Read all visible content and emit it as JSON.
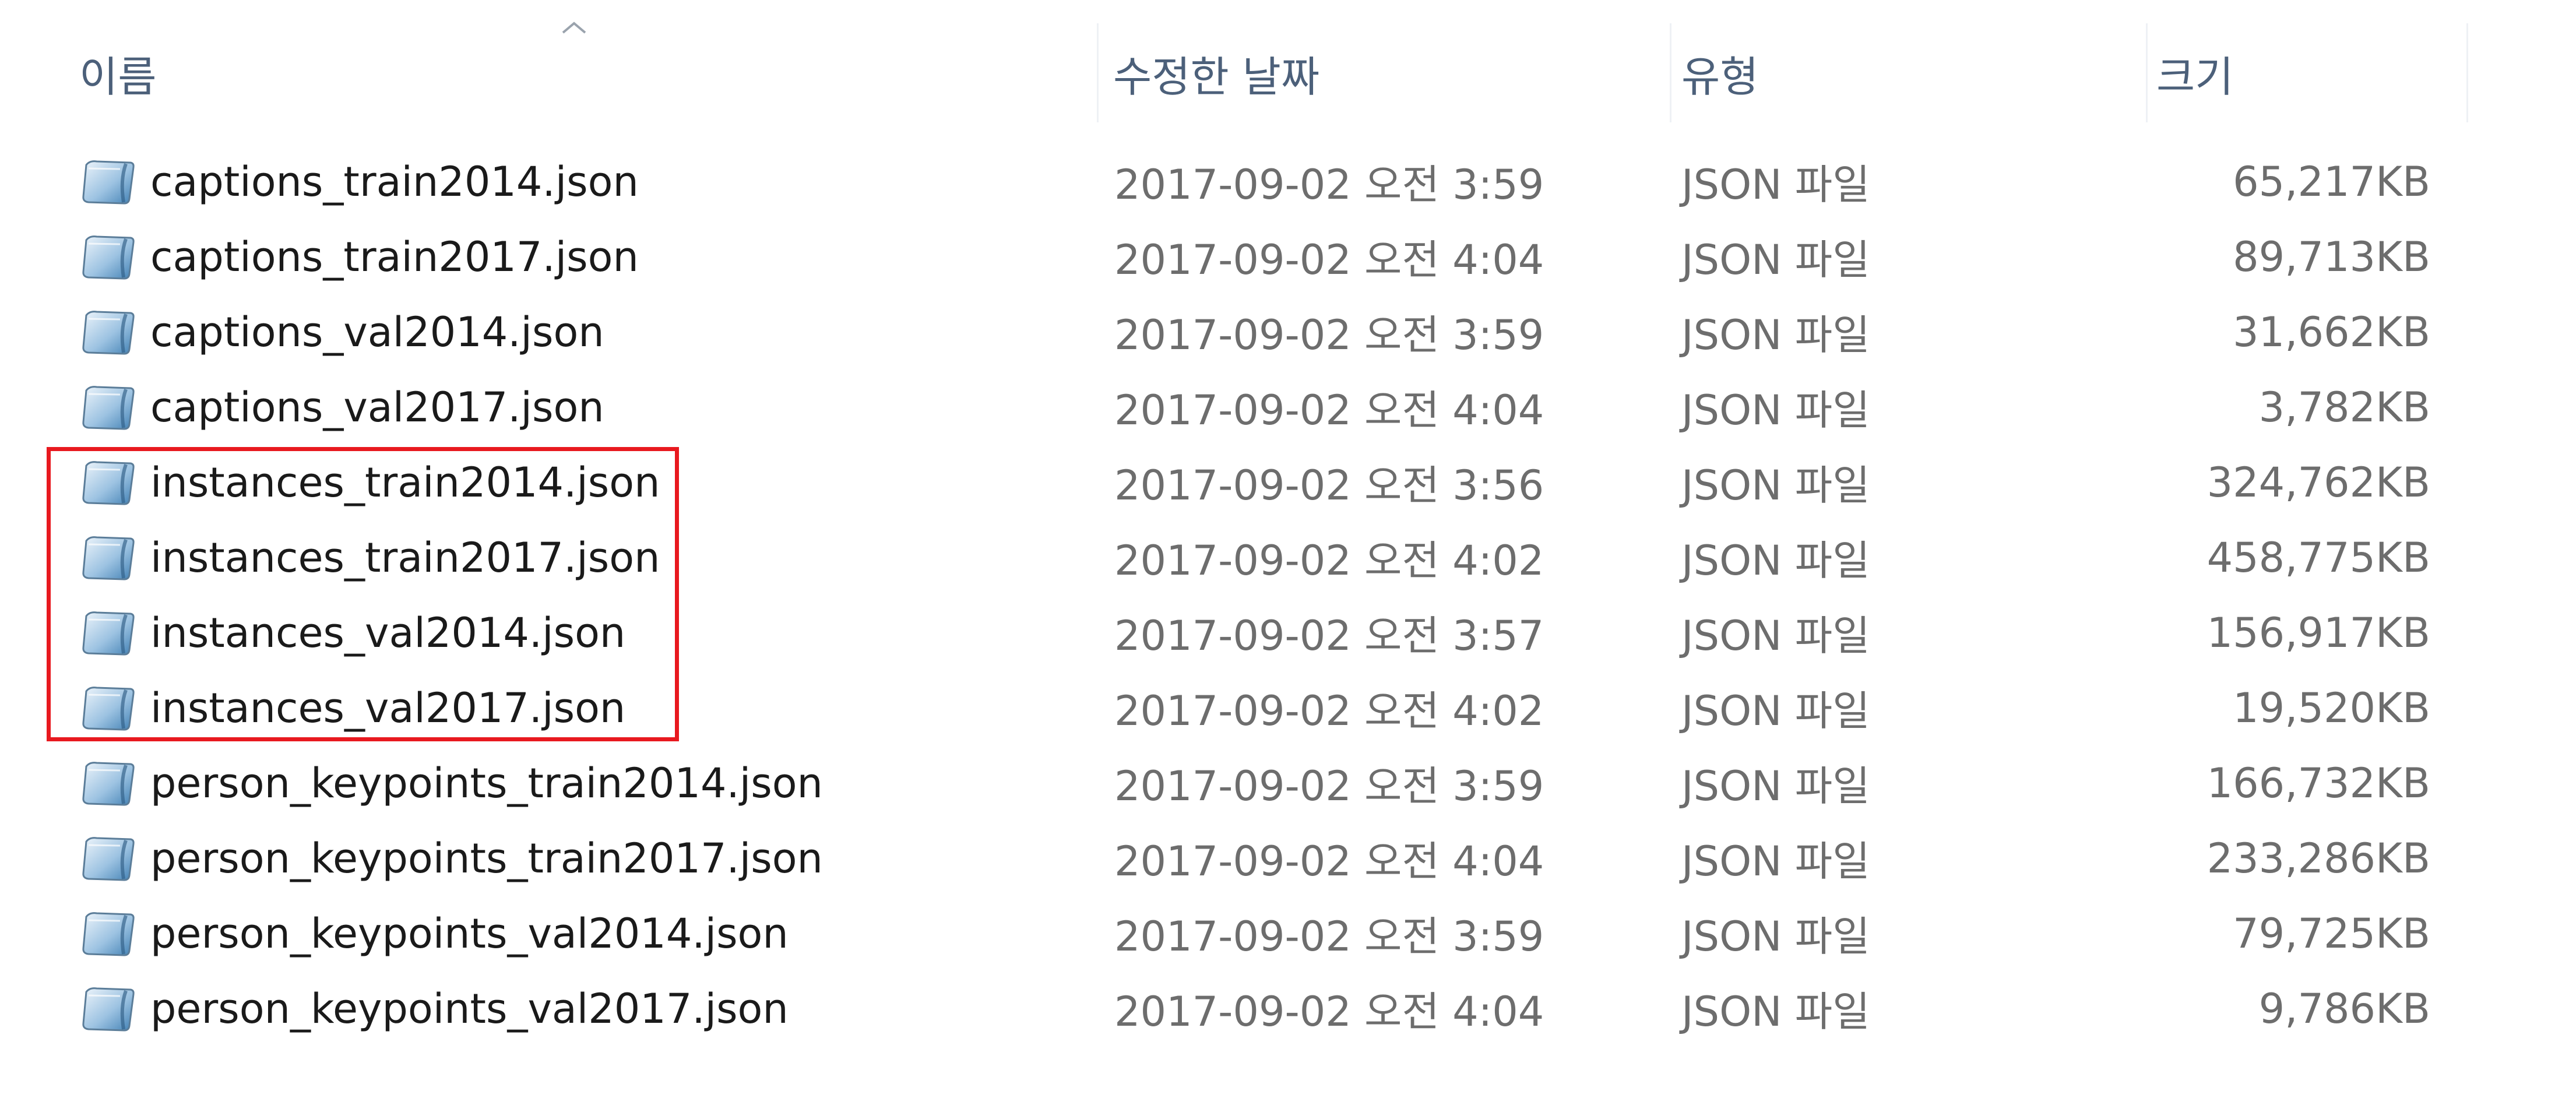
{
  "header": {
    "columns": {
      "name": "이름",
      "date": "수정한 날짜",
      "type": "유형",
      "size": "크기"
    }
  },
  "files": [
    {
      "name": "captions_train2014.json",
      "date": "2017-09-02 오전 3:59",
      "type": "JSON 파일",
      "size": "65,217KB"
    },
    {
      "name": "captions_train2017.json",
      "date": "2017-09-02 오전 4:04",
      "type": "JSON 파일",
      "size": "89,713KB"
    },
    {
      "name": "captions_val2014.json",
      "date": "2017-09-02 오전 3:59",
      "type": "JSON 파일",
      "size": "31,662KB"
    },
    {
      "name": "captions_val2017.json",
      "date": "2017-09-02 오전 4:04",
      "type": "JSON 파일",
      "size": "3,782KB"
    },
    {
      "name": "instances_train2014.json",
      "date": "2017-09-02 오전 3:56",
      "type": "JSON 파일",
      "size": "324,762KB"
    },
    {
      "name": "instances_train2017.json",
      "date": "2017-09-02 오전 4:02",
      "type": "JSON 파일",
      "size": "458,775KB"
    },
    {
      "name": "instances_val2014.json",
      "date": "2017-09-02 오전 3:57",
      "type": "JSON 파일",
      "size": "156,917KB"
    },
    {
      "name": "instances_val2017.json",
      "date": "2017-09-02 오전 4:02",
      "type": "JSON 파일",
      "size": "19,520KB"
    },
    {
      "name": "person_keypoints_train2014.json",
      "date": "2017-09-02 오전 3:59",
      "type": "JSON 파일",
      "size": "166,732KB"
    },
    {
      "name": "person_keypoints_train2017.json",
      "date": "2017-09-02 오전 4:04",
      "type": "JSON 파일",
      "size": "233,286KB"
    },
    {
      "name": "person_keypoints_val2014.json",
      "date": "2017-09-02 오전 3:59",
      "type": "JSON 파일",
      "size": "79,725KB"
    },
    {
      "name": "person_keypoints_val2017.json",
      "date": "2017-09-02 오전 4:04",
      "type": "JSON 파일",
      "size": "9,786KB"
    }
  ],
  "icons": {
    "file": "json-file-icon",
    "sort": "sort-ascending-caret-icon"
  },
  "colors": {
    "highlight": "#e8191f",
    "header_text": "#4c607a",
    "detail_text": "#6d6d6d"
  }
}
